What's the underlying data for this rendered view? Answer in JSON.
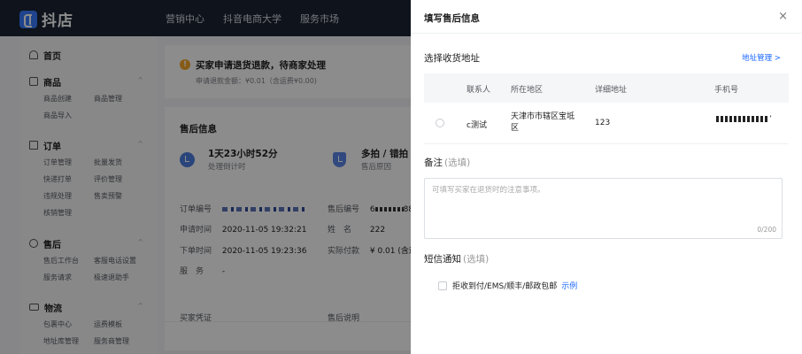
{
  "topbar": {
    "brand": "抖店",
    "nav": [
      "营销中心",
      "抖音电商大学",
      "服务市场"
    ]
  },
  "sidebar": {
    "home": "首页",
    "groups": [
      {
        "title": "商品",
        "items": [
          "商品创建",
          "商品管理",
          "商品导入"
        ]
      },
      {
        "title": "订单",
        "items": [
          "订单管理",
          "批量发货",
          "快递打单",
          "评价管理",
          "违规处理",
          "售卖预警",
          "核销管理"
        ]
      },
      {
        "title": "售后",
        "items": [
          "售后工作台",
          "客服电话设置",
          "服务请求",
          "极速退助手"
        ]
      },
      {
        "title": "物流",
        "items": [
          "包裹中心",
          "运费模板",
          "地址库管理",
          "服务商管理"
        ]
      }
    ]
  },
  "notice": {
    "icon": "!",
    "title": "买家申请退货退款，待商家处理",
    "refund_label": "申请退款金额：",
    "refund_value": "¥0.01（含运费¥0.00)"
  },
  "aftersale": {
    "title": "售后信息",
    "countdown": {
      "value": "1天23小时52分",
      "label": "处理倒计时"
    },
    "reason": {
      "value": "多拍 / 错拍 /",
      "label": "售后原因"
    },
    "fields": {
      "order_no_label": "订单编号",
      "apply_time_label": "申请时间",
      "apply_time": "2020-11-05 19:32:21",
      "order_time_label": "下单时间",
      "order_time": "2020-11-05 19:23:36",
      "service_label": "服　务",
      "service": "-",
      "aftersale_no_label": "售后编号",
      "aftersale_no_prefix": "6",
      "aftersale_no_suffix": "88",
      "name_label": "姓　名",
      "name": "222",
      "refund_label": "实际付款",
      "refund": "¥ 0.01 (含运"
    },
    "buyer_proof": "买家凭证",
    "aftersale_note": "售后说明"
  },
  "drawer": {
    "title": "填写售后信息",
    "close": "×",
    "address_section": "选择收货地址",
    "address_link": "地址管理 >",
    "table_headers": [
      "联系人",
      "所在地区",
      "详细地址",
      "手机号"
    ],
    "addresses": [
      {
        "contact": "c测试",
        "region": "天津市市辖区宝坻区",
        "detail": "123",
        "phone_suffix": "’"
      }
    ],
    "remark_label": "备注",
    "remark_optional": "(选填)",
    "remark_placeholder": "可填写买家在退货时的注意事项。",
    "remark_counter": "0/200",
    "sms_label": "短信通知",
    "sms_optional": "(选填)",
    "sms_option": "拒收到付/EMS/顺丰/邮政包邮",
    "sms_example": "示例"
  }
}
